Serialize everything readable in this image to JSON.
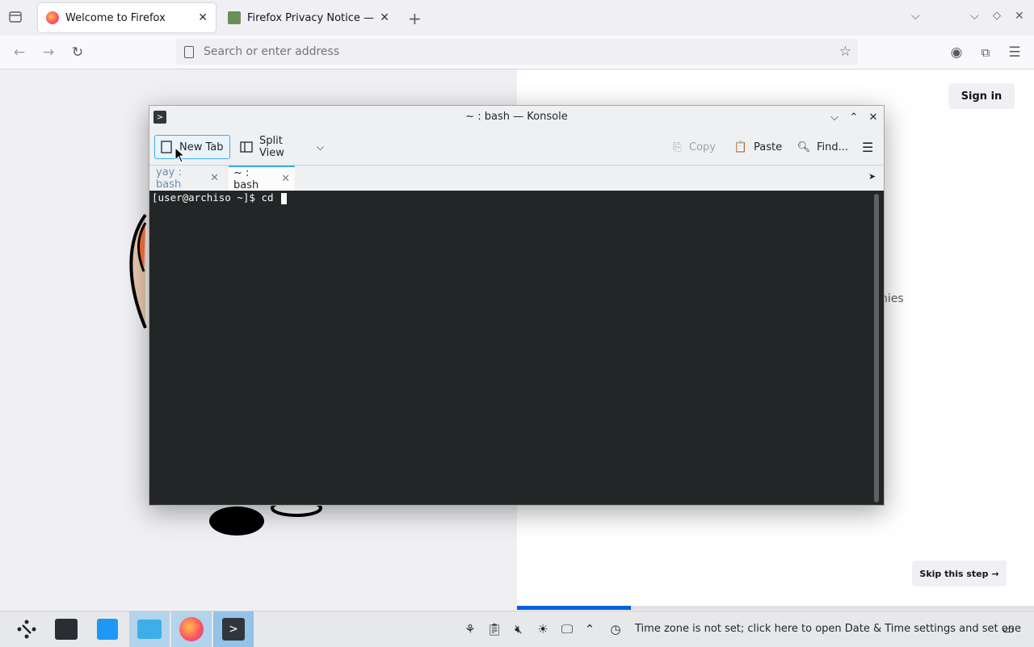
{
  "browser": {
    "tabs": [
      {
        "label": "Welcome to Firefox"
      },
      {
        "label": "Firefox Privacy Notice — M"
      }
    ],
    "url_placeholder": "Search or enter address"
  },
  "page": {
    "sign_in_label": "Sign in",
    "skip_label": "Skip this step →",
    "partial_text": "nies",
    "progress_fraction": 0.22
  },
  "konsole": {
    "title": "~ : bash — Konsole",
    "toolbar": {
      "new_tab": "New Tab",
      "split_view": "Split View",
      "copy": "Copy",
      "paste": "Paste",
      "find": "Find..."
    },
    "tabs": [
      {
        "label": "yay : bash"
      },
      {
        "label": "~ : bash"
      }
    ],
    "terminal": {
      "prompt": "[user@archiso ~]$ cd "
    }
  },
  "taskbar": {
    "status_message": "Time zone is not set; click here to open Date & Time settings and set one"
  },
  "colors": {
    "accent": "#0060df",
    "konsole_accent": "#3daee9",
    "terminal_bg": "#232627"
  }
}
